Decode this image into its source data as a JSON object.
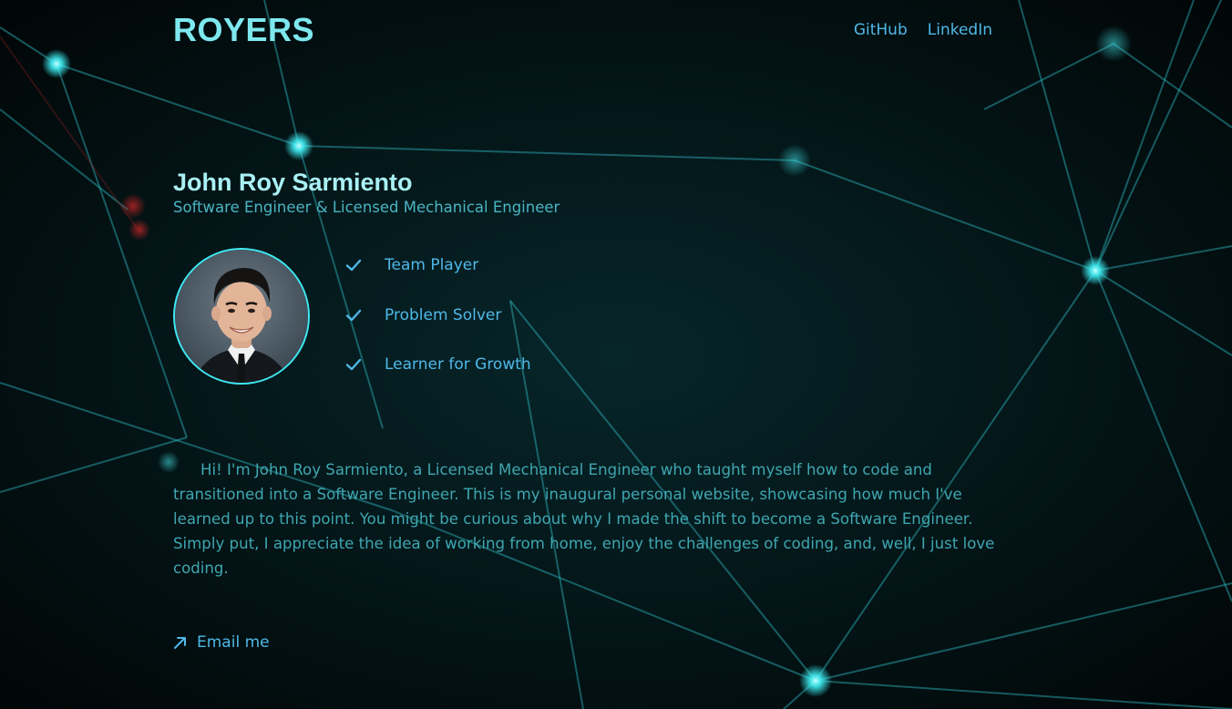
{
  "header": {
    "logo": "ROYERS",
    "nav": [
      {
        "label": "GitHub"
      },
      {
        "label": "LinkedIn"
      }
    ]
  },
  "profile": {
    "name": "John Roy Sarmiento",
    "subtitle": "Software Engineer & Licensed Mechanical Engineer",
    "avatar_icon": "profile-photo",
    "traits": [
      {
        "label": "Team Player",
        "icon": "check-icon"
      },
      {
        "label": "Problem Solver",
        "icon": "check-icon"
      },
      {
        "label": "Learner for Growth",
        "icon": "check-icon"
      }
    ]
  },
  "bio": {
    "text": "Hi! I'm John Roy Sarmiento, a Licensed Mechanical Engineer who taught myself how to code and transitioned into a Software Engineer. This is my inaugural personal website, showcasing how much I've learned up to this point. You might be curious about why I made the shift to become a Software Engineer. Simply put, I appreciate the idea of working from home, enjoy the challenges of coding, and, well, I just love coding."
  },
  "contact": {
    "email_label": "Email me",
    "email_icon": "arrow-up-right-icon"
  },
  "colors": {
    "background": "#020c0d",
    "logo": "#7ee8ef",
    "name": "#a9f0f4",
    "link": "#4fb8e8",
    "text": "#3fa6b0",
    "accent": "#3ee8f2"
  }
}
